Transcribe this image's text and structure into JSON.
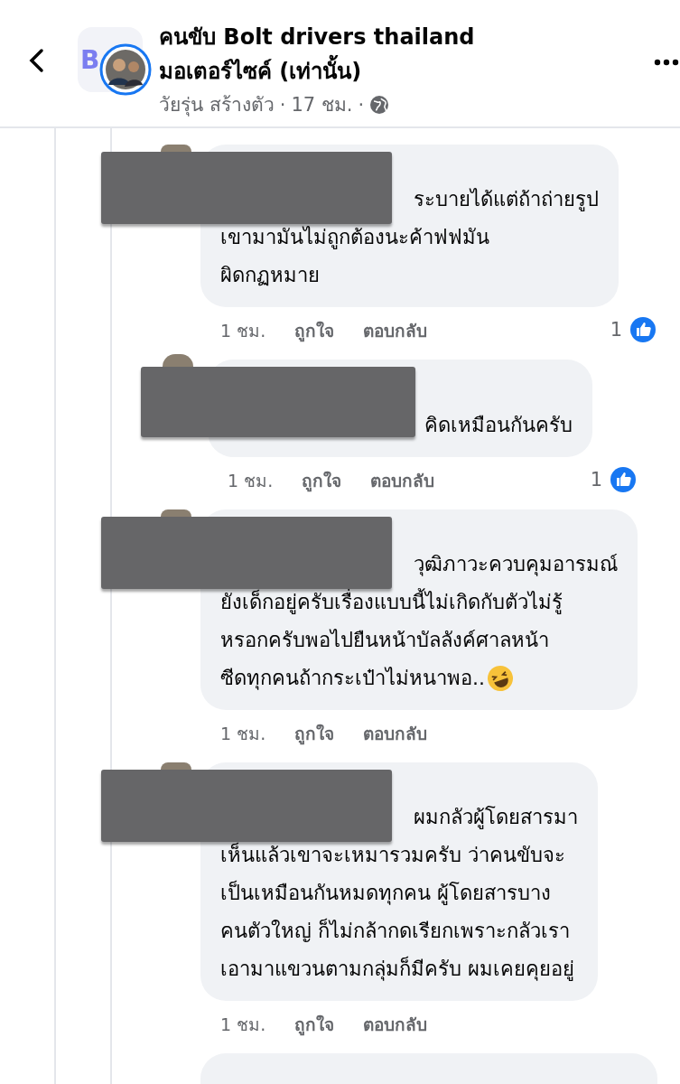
{
  "header": {
    "title_lines": [
      "คนขับ Bolt drivers thailand",
      "มอเตอร์ไซค์ (เท่านั้น)"
    ],
    "group_logo_text": "B",
    "author": "วัยรุ่น สร้างตัว",
    "separator": "·",
    "time": "17 ชม.",
    "public": true
  },
  "comments": [
    {
      "reply": false,
      "lines": [
        "ระบายได้แต่ถ้าถ่ายรูป",
        "เขามามันไม่ถูกต้องนะค้าฟฟมัน",
        "ผิดกฏหมาย"
      ],
      "time": "1 ชม.",
      "like": "ถูกใจ",
      "reply_label": "ตอบกลับ",
      "reactions": "1"
    },
    {
      "reply": true,
      "lines": [
        "คิดเหมือนกันครับ"
      ],
      "time": "1 ชม.",
      "like": "ถูกใจ",
      "reply_label": "ตอบกลับ",
      "reactions": "1"
    },
    {
      "reply": false,
      "lines": [
        "วุฒิภาวะควบคุมอารมณ์",
        "ยังเด็กอยู่ครับเรื่องแบบนี้ไม่เกิดกับตัวไม่รู้",
        "หรอกครับพอไปยืนหน้าบัลลังค์ศาลหน้า",
        "ซีดทุกคนถ้ากระเป๋าไม่หนาพอ.."
      ],
      "laughing_emoji": true,
      "time": "1 ชม.",
      "like": "ถูกใจ",
      "reply_label": "ตอบกลับ"
    },
    {
      "reply": false,
      "lines": [
        "ผมกลัวผู้โดยสารมา",
        "เห็นแล้วเขาจะเหมารวมครับ ว่าคนขับจะ",
        "เป็นเหมือนกันหมดทุกคน ผู้โดยสารบาง",
        "คนตัวใหญ่ ก็ไม่กล้ากดเรียกเพราะกลัวเรา",
        "เอามาแขวนตามกลุ่มก็มีครับ ผมเคยคุยอยู่"
      ],
      "time": "1 ชม.",
      "like": "ถูกใจ",
      "reply_label": "ตอบกลับ"
    }
  ]
}
